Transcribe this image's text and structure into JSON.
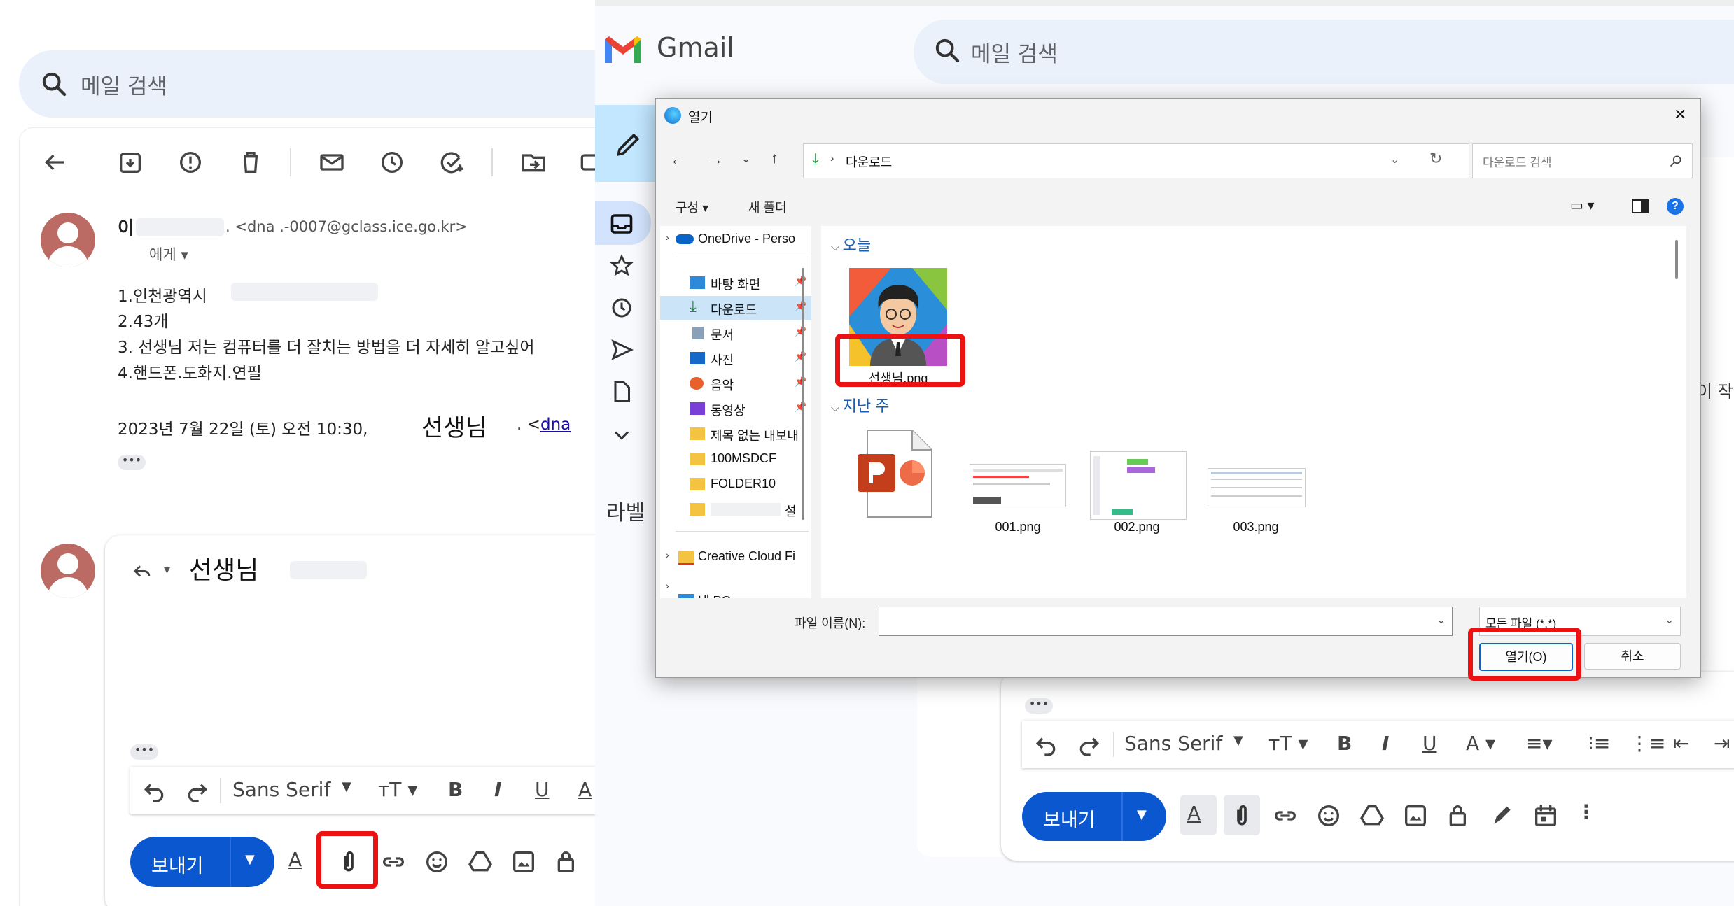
{
  "left_gmail": {
    "search_placeholder": "메일 검색",
    "sender_initial": "이",
    "sender_email": ". <dna   .-0007@gclass.ice.go.kr>",
    "to_me": "에게 ▾",
    "body_lines": [
      "1.인천광역시",
      "2.43개",
      "3. 선생님 저는 컴퓨터를 더 잘치는 방법을 더 자세히 알고싶어",
      "4.핸드폰.도화지.연필"
    ],
    "quote_date": "2023년 7월 22일 (토) 오전 10:30,",
    "quote_name": "선생님",
    "quote_email_prefix": ". <",
    "quote_email_link": "dna",
    "more_dots": "•••",
    "reply_to_name": "선생님",
    "compose_dots": "•••",
    "format": {
      "font": "Sans Serif",
      "size": "тT ▾",
      "bold": "B",
      "italic": "I",
      "underline": "U",
      "color": "A"
    },
    "send_label": "보내기"
  },
  "right_gmail": {
    "brand": "Gmail",
    "search_placeholder": "메일 검색",
    "labels_heading": "라벨",
    "partial_text": "이 작",
    "compose_dots": "•••",
    "format": {
      "font": "Sans Serif",
      "size": "тT ▾",
      "bold": "B",
      "italic": "I",
      "underline": "U",
      "color": "A ▾"
    },
    "send_label": "보내기"
  },
  "dialog": {
    "title": "열기",
    "close": "✕",
    "breadcrumb": "다운로드",
    "search_placeholder": "다운로드 검색",
    "organize": "구성 ▾",
    "new_folder": "새 폴더",
    "nav_items": [
      {
        "label": "OneDrive - Perso",
        "icon": "cloud-icon"
      },
      {
        "label": "바탕 화면",
        "icon": "desktop-icon"
      },
      {
        "label": "다운로드",
        "icon": "download-icon"
      },
      {
        "label": "문서",
        "icon": "document-icon"
      },
      {
        "label": "사진",
        "icon": "pictures-icon"
      },
      {
        "label": "음악",
        "icon": "music-icon"
      },
      {
        "label": "동영상",
        "icon": "video-icon"
      },
      {
        "label": "제목 없는 내보내",
        "icon": "folder-icon"
      },
      {
        "label": "100MSDCF",
        "icon": "folder-icon"
      },
      {
        "label": "FOLDER10",
        "icon": "folder-icon"
      },
      {
        "label": "설",
        "icon": "folder-icon"
      },
      {
        "label": "Creative Cloud Fi",
        "icon": "creative-cloud-icon"
      },
      {
        "label": "내 PC",
        "icon": "pc-icon"
      }
    ],
    "group_today": "오늘",
    "group_lastweek": "지난 주",
    "files_today": [
      {
        "name": "선생님.png"
      }
    ],
    "files_lastweek": [
      {
        "name": ""
      },
      {
        "name": "001.png"
      },
      {
        "name": "002.png"
      },
      {
        "name": "003.png"
      }
    ],
    "filename_label": "파일 이름(N):",
    "filter": "모든 파일 (*.*)",
    "open_button": "열기(O)",
    "cancel_button": "취소"
  },
  "colors": {
    "highlight": "#ee1111",
    "send_blue": "#0b57d0",
    "search_bg": "#eaf1fb",
    "group_blue": "#1a5fb4"
  }
}
